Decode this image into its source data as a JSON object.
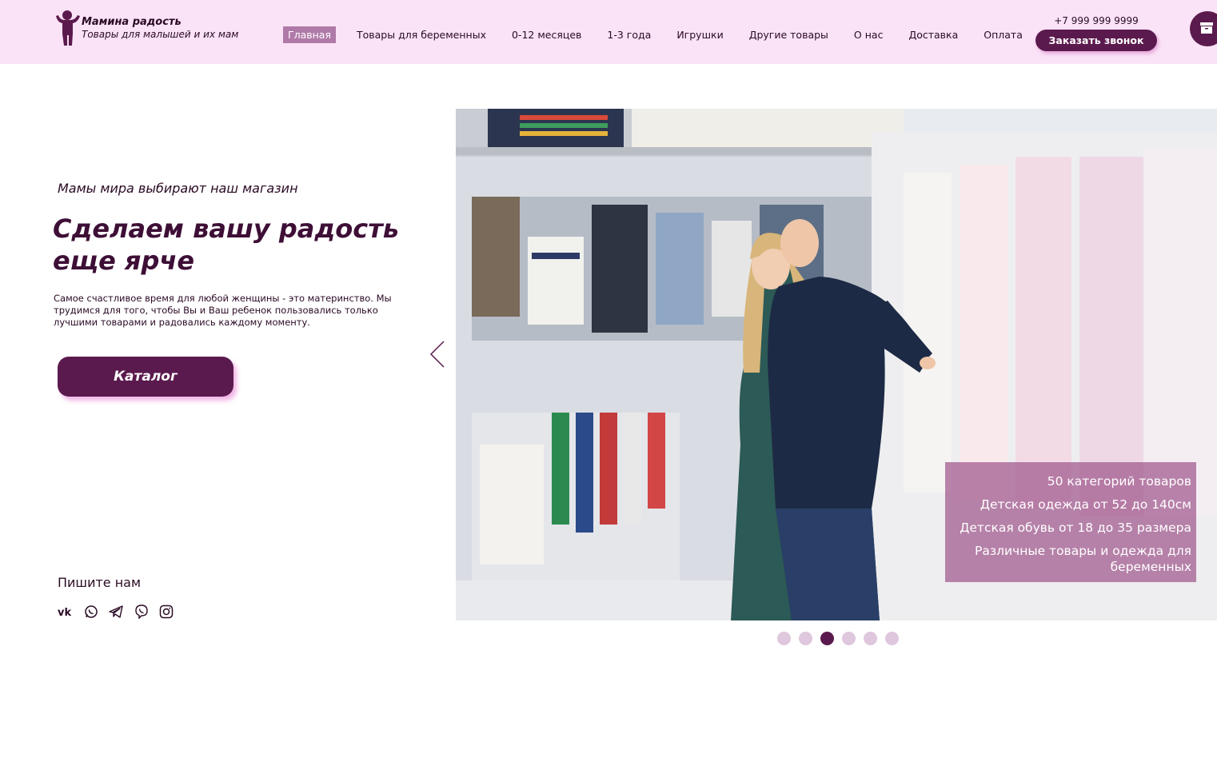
{
  "brand": {
    "title": "Мамина радость",
    "subtitle": "Товары для малышей и их мам",
    "icon": "baby-figure-icon"
  },
  "nav": {
    "items": [
      {
        "label": "Главная",
        "active": true
      },
      {
        "label": "Товары для беременных"
      },
      {
        "label": "0-12 месяцев"
      },
      {
        "label": "1-3 года"
      },
      {
        "label": "Игрушки"
      },
      {
        "label": "Другие товары"
      },
      {
        "label": "О нас"
      },
      {
        "label": "Доставка"
      },
      {
        "label": "Оплата"
      }
    ]
  },
  "contact": {
    "phone": "+7 999 999 9999",
    "callback_label": "Заказать звонок",
    "cart_icon": "cart-icon"
  },
  "hero": {
    "tagline": "Мамы мира выбирают наш магазин",
    "title": "Сделаем вашу радость еще ярче",
    "text": "Самое счастливое время для любой женщины - это материнство. Мы трудимся для того, чтобы Вы и Ваш ребенок пользовались только лучшими товарами и радовались каждому моменту.",
    "catalog_label": "Каталог"
  },
  "write_us": {
    "label": "Пишите нам",
    "socials": [
      "vk-icon",
      "whatsapp-icon",
      "telegram-icon",
      "viber-icon",
      "instagram-icon"
    ]
  },
  "slider": {
    "features": [
      "50 категорий товаров",
      "Детская одежда от 52 до 140см",
      "Детская обувь от 18 до 35 размера",
      "Различные товары и одежда для беременных"
    ],
    "dots_count": 6,
    "active_dot": 3
  },
  "colors": {
    "header_bg": "#fbe3f7",
    "accent": "#5b1a4d",
    "active_nav": "#b07aa8",
    "dot_inactive": "#dfc7dd"
  }
}
